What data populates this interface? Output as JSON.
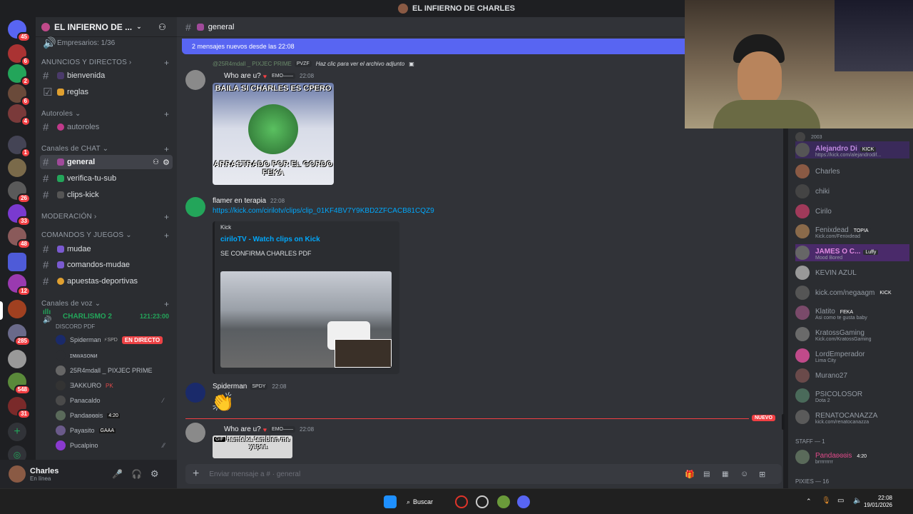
{
  "window_title": "EL INFIERNO DE CHARLES",
  "guilds": {
    "badges": [
      "45",
      "6",
      "2",
      "6",
      "4",
      "1",
      "26",
      "33",
      "48",
      "12",
      "285",
      "548",
      "31"
    ]
  },
  "server": {
    "name": "EL INFIERNO DE ...",
    "top_channel": "Empresarios: 1/36"
  },
  "categories": {
    "anuncios": "ANUNCIOS Y DIRECTOS",
    "autoroles": "Autoroles",
    "chat": "Canales de CHAT",
    "moderacion": "MODERACIÓN",
    "comandos": "COMANDOS Y JUEGOS",
    "voz": "Canales de voz"
  },
  "channels": {
    "bienvenida": "bienvenida",
    "reglas": "reglas",
    "autoroles": "autoroles",
    "general": "general",
    "verifica": "verifica-tu-sub",
    "clips": "clips-kick",
    "mudae": "mudae",
    "comandos_mudae": "comandos-mudae",
    "apuestas": "apuestas-deportivas"
  },
  "voice": {
    "channel": "CHARLISMO 2",
    "timer": "121:23:00",
    "sub": "DISCORD PDF",
    "live_label": "EN DIRECTO",
    "users": [
      "Spiderman",
      "ɪɴᴡᴀsᴏɴᴎ",
      "25R4mdall _ PIXJEC PRIME",
      "ƎAKKURO",
      "Panacaldo",
      "Pandaʚɞɞis",
      "Payasito",
      "Pucalpino"
    ],
    "tags": {
      "panda": "4:20",
      "payasito": "GAAA",
      "akkuro": "PK"
    }
  },
  "user": {
    "name": "Charles",
    "status": "En línea"
  },
  "chat": {
    "channel_name": "general",
    "new_messages": "2 mensajes nuevos desde las 22:08",
    "reply_text": "Haz clic para ver el archivo adjunto",
    "reply_user": "@25R4mdall _ PIXJEC PRIME",
    "reply_tag": "PVZF",
    "msg1": {
      "user": "Who are u?",
      "tag": "EMO——",
      "time": "22:08",
      "caption_top": "BAILA SI CHARLES ES CPERO",
      "caption_bottom": "ARRASTRADO POR EL GORDO FEKA"
    },
    "msg2": {
      "user": "flamer en terapia",
      "time": "22:08",
      "link": "https://kick.com/cirilotv/clips/clip_01KF4BV7Y9KBD2ZFCACB81CQZ9",
      "embed_site": "Kick",
      "embed_title": "ciriloTV - Watch clips on Kick",
      "embed_desc": "SE CONFIRMA CHARLES PDF"
    },
    "msg3": {
      "user": "Spiderman",
      "tag": "SPDY",
      "time": "22:08",
      "emoji": "👏"
    },
    "new_label": "NUEVO",
    "msg4": {
      "user": "Who are u?",
      "tag": "EMO——",
      "time": "22:08",
      "gif_label": "GIF",
      "gif_text": "hamteka tambien me yapea"
    },
    "composer_placeholder": "Enviar mensaje a #  · general"
  },
  "members": [
    {
      "name": "2003",
      "sub": ""
    },
    {
      "name": "Alejandro Di",
      "tag": "KICK",
      "sub": "https://kick.com/alejandrodif..."
    },
    {
      "name": "Charles",
      "sub": ""
    },
    {
      "name": "chiki",
      "sub": ""
    },
    {
      "name": "Cirilo",
      "sub": ""
    },
    {
      "name": "Fenixdead",
      "tag": "TOPIA",
      "sub": "Kick.com/Fenixdead"
    },
    {
      "name": "JAMES O C...",
      "tag": "Luffy",
      "sub": "Mood Bored"
    },
    {
      "name": "KEVIN AZUL",
      "sub": ""
    },
    {
      "name": "kick.com/negaagm",
      "tag": "KICK",
      "sub": ""
    },
    {
      "name": "Klatito",
      "tag": "FEKA",
      "sub": "Asi como te gusta baby"
    },
    {
      "name": "KratossGaming",
      "sub": "Kick.com/KratossGaming"
    },
    {
      "name": "LordEmperador",
      "sub": "Lima City"
    },
    {
      "name": "Murano27",
      "sub": ""
    },
    {
      "name": "PSICOLOSOR",
      "sub": "Dota 2"
    },
    {
      "name": "RENATOCANAZZA",
      "sub": "kick.com/renatocanazza"
    }
  ],
  "staff_label": "STAFF — 1",
  "staff_member": {
    "name": "Pandaʚɞɞis",
    "tag": "4:20",
    "sub": "brrrrrrrrr"
  },
  "pixies_label": "PIXIES — 16",
  "taskbar": {
    "search": "Buscar",
    "time": "22:08",
    "date": "19/01/2026"
  }
}
